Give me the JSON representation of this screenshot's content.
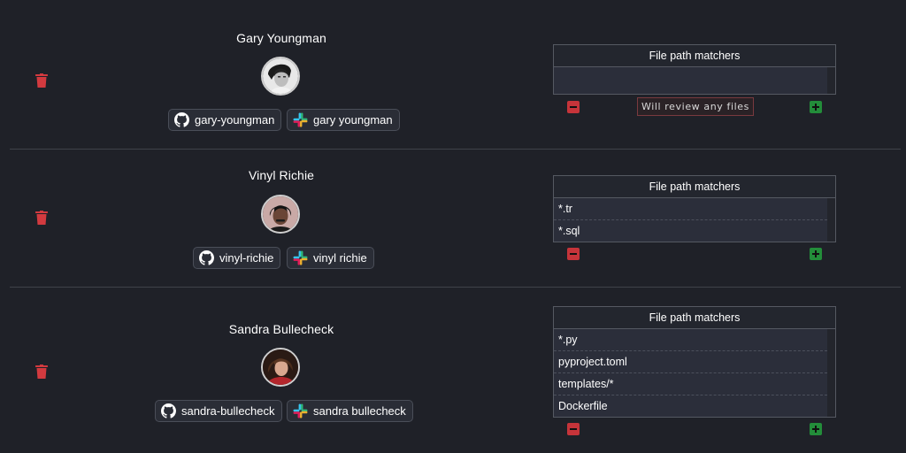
{
  "reviewers": [
    {
      "name": "Gary Youngman",
      "github": "gary-youngman",
      "slack": "gary youngman",
      "matchers_title": "File path matchers",
      "matchers": [],
      "empty_note": "Will review any files"
    },
    {
      "name": "Vinyl Richie",
      "github": "vinyl-richie",
      "slack": "vinyl richie",
      "matchers_title": "File path matchers",
      "matchers": [
        "*.tr",
        "*.sql"
      ]
    },
    {
      "name": "Sandra Bullecheck",
      "github": "sandra-bullecheck",
      "slack": "sandra bullecheck",
      "matchers_title": "File path matchers",
      "matchers": [
        "*.py",
        "pyproject.toml",
        "templates/*",
        "Dockerfile"
      ]
    }
  ],
  "icons": {
    "delete": "trash-icon",
    "github": "github-icon",
    "slack": "slack-icon",
    "remove": "minus-icon",
    "add": "plus-icon"
  },
  "colors": {
    "background": "#1f2128",
    "delete": "#d23a3f",
    "remove_button": "#c6343a",
    "add_button": "#238d3a"
  }
}
